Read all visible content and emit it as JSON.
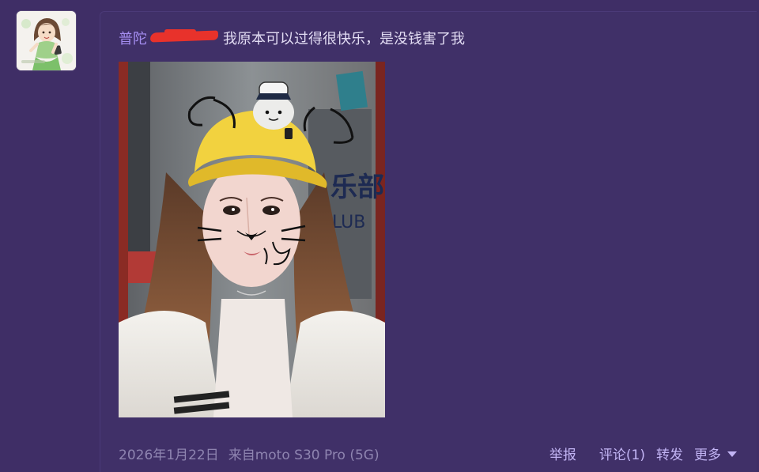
{
  "post": {
    "username": "普陀",
    "text": "我原本可以过得很快乐，是没钱害了我",
    "date": "2026年1月22日",
    "source": "来自moto S30 Pro (5G)"
  },
  "actions": {
    "report": "举报",
    "comment": "评论(1)",
    "repost": "转发",
    "more": "更多"
  },
  "icons": {
    "more": "caret-down-icon"
  },
  "colors": {
    "background": "#3f2e66",
    "username": "#a48df0",
    "link": "#c2b4f4",
    "meta": "#8e84b0",
    "redaction": "#e8322b"
  }
}
